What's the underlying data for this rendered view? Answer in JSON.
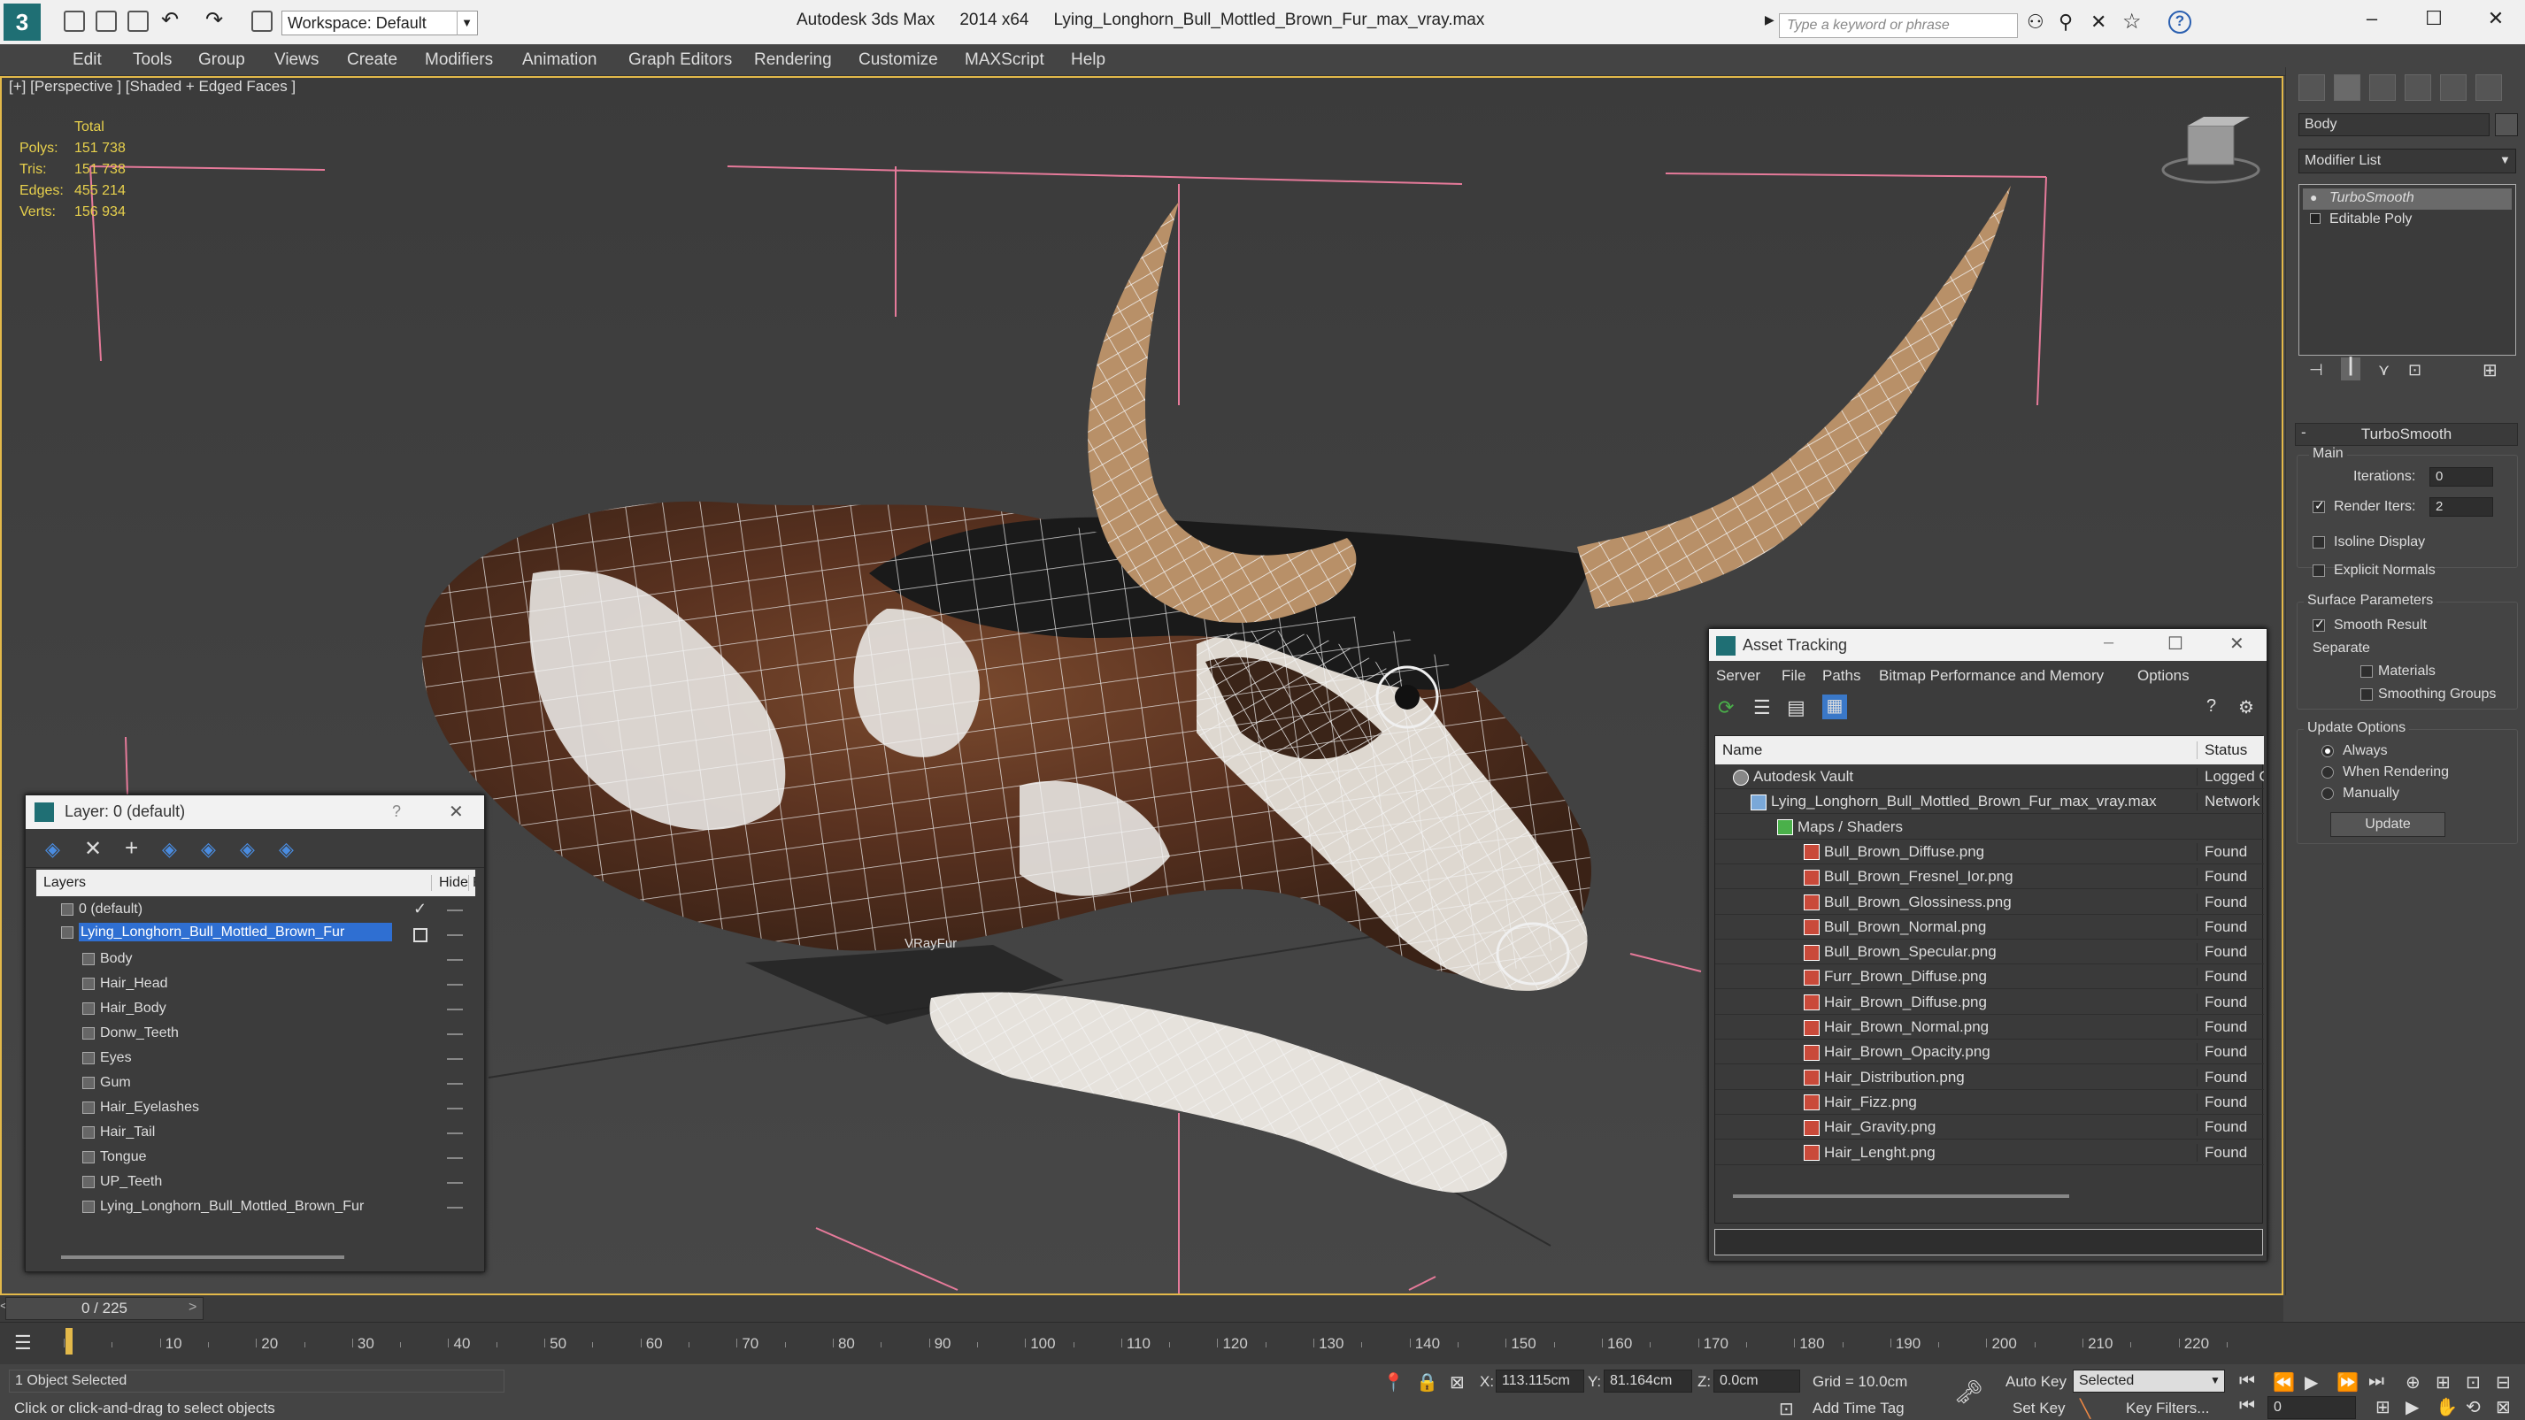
{
  "app": {
    "name": "Autodesk 3ds Max",
    "version": "2014 x64",
    "file": "Lying_Longhorn_Bull_Mottled_Brown_Fur_max_vray.max",
    "workspace": "Workspace: Default",
    "search_placeholder": "Type a keyword or phrase"
  },
  "menu": [
    "Edit",
    "Tools",
    "Group",
    "Views",
    "Create",
    "Modifiers",
    "Animation",
    "Graph Editors",
    "Rendering",
    "Customize",
    "MAXScript",
    "Help"
  ],
  "viewport": {
    "label": "[+] [Perspective ] [Shaded + Edged Faces ]",
    "stats_header": "Total",
    "stats": [
      {
        "label": "Polys:",
        "value": "151 738"
      },
      {
        "label": "Tris:",
        "value": "151 738"
      },
      {
        "label": "Edges:",
        "value": "455 214"
      },
      {
        "label": "Verts:",
        "value": "156 934"
      }
    ],
    "object_label": "VRayFur"
  },
  "layer_panel": {
    "title": "Layer: 0 (default)",
    "help": "?",
    "col_layers": "Layers",
    "col_hide": "Hide",
    "col_f": "F",
    "rows": [
      {
        "name": "0 (default)",
        "level": 0,
        "checked": true
      },
      {
        "name": "Lying_Longhorn_Bull_Mottled_Brown_Fur",
        "level": 0,
        "selected": true
      },
      {
        "name": "Body",
        "level": 1
      },
      {
        "name": "Hair_Head",
        "level": 1
      },
      {
        "name": "Hair_Body",
        "level": 1
      },
      {
        "name": "Donw_Teeth",
        "level": 1
      },
      {
        "name": "Eyes",
        "level": 1
      },
      {
        "name": "Gum",
        "level": 1
      },
      {
        "name": "Hair_Eyelashes",
        "level": 1
      },
      {
        "name": "Hair_Tail",
        "level": 1
      },
      {
        "name": "Tongue",
        "level": 1
      },
      {
        "name": "UP_Teeth",
        "level": 1
      },
      {
        "name": "Lying_Longhorn_Bull_Mottled_Brown_Fur",
        "level": 1
      }
    ]
  },
  "asset_tracking": {
    "title": "Asset Tracking",
    "menu": [
      "Server",
      "File",
      "Paths",
      "Bitmap Performance and Memory",
      "Options"
    ],
    "col_name": "Name",
    "col_status": "Status",
    "rows": [
      {
        "name": "Autodesk Vault",
        "status": "Logged Out",
        "level": 0
      },
      {
        "name": "Lying_Longhorn_Bull_Mottled_Brown_Fur_max_vray.max",
        "status": "Network",
        "level": 1
      },
      {
        "name": "Maps / Shaders",
        "status": "",
        "level": 2
      },
      {
        "name": "Bull_Brown_Diffuse.png",
        "status": "Found",
        "level": 3
      },
      {
        "name": "Bull_Brown_Fresnel_Ior.png",
        "status": "Found",
        "level": 3
      },
      {
        "name": "Bull_Brown_Glossiness.png",
        "status": "Found",
        "level": 3
      },
      {
        "name": "Bull_Brown_Normal.png",
        "status": "Found",
        "level": 3
      },
      {
        "name": "Bull_Brown_Specular.png",
        "status": "Found",
        "level": 3
      },
      {
        "name": "Furr_Brown_Diffuse.png",
        "status": "Found",
        "level": 3
      },
      {
        "name": "Hair_Brown_Diffuse.png",
        "status": "Found",
        "level": 3
      },
      {
        "name": "Hair_Brown_Normal.png",
        "status": "Found",
        "level": 3
      },
      {
        "name": "Hair_Brown_Opacity.png",
        "status": "Found",
        "level": 3
      },
      {
        "name": "Hair_Distribution.png",
        "status": "Found",
        "level": 3
      },
      {
        "name": "Hair_Fizz.png",
        "status": "Found",
        "level": 3
      },
      {
        "name": "Hair_Gravity.png",
        "status": "Found",
        "level": 3
      },
      {
        "name": "Hair_Lenght.png",
        "status": "Found",
        "level": 3
      }
    ]
  },
  "command_panel": {
    "object_name": "Body",
    "modifier_list": "Modifier List",
    "stack": [
      "TurboSmooth",
      "Editable Poly"
    ],
    "rollout_title": "TurboSmooth",
    "main": "Main",
    "iterations_label": "Iterations:",
    "iterations_value": "0",
    "render_iters_label": "Render Iters:",
    "render_iters_value": "2",
    "isoline": "Isoline Display",
    "explicit_normals": "Explicit Normals",
    "surface_params": "Surface Parameters",
    "smooth_result": "Smooth Result",
    "separate": "Separate",
    "materials": "Materials",
    "smoothing_groups": "Smoothing Groups",
    "update_options": "Update Options",
    "always": "Always",
    "when_rendering": "When Rendering",
    "manually": "Manually",
    "update_btn": "Update"
  },
  "timeline": {
    "frame": "0 / 225",
    "ticks": [
      "0",
      "10",
      "20",
      "30",
      "40",
      "50",
      "60",
      "70",
      "80",
      "90",
      "100",
      "110",
      "120",
      "130",
      "140",
      "150",
      "160",
      "170",
      "180",
      "190",
      "200",
      "210",
      "220"
    ]
  },
  "status": {
    "selection": "1 Object Selected",
    "prompt": "Click or click-and-drag to select objects",
    "x_label": "X:",
    "x_value": "113.115cm",
    "y_label": "Y:",
    "y_value": "81.164cm",
    "z_label": "Z:",
    "z_value": "0.0cm",
    "grid": "Grid = 10.0cm",
    "auto_key": "Auto Key",
    "selected": "Selected",
    "set_key": "Set Key",
    "key_filters": "Key Filters...",
    "add_time_tag": "Add Time Tag",
    "frame_value": "0"
  },
  "colors": {
    "accent": "#e3b94a",
    "selection": "#2f6fd2",
    "stats": "#e7d04c"
  }
}
